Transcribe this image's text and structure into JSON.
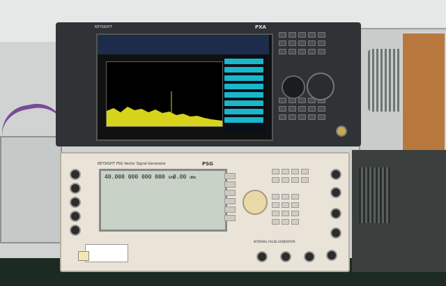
{
  "scene": {
    "description_free": true
  },
  "analyzer": {
    "brand": "KEYSIGHT",
    "model": "PXA",
    "colors": {
      "softkey": "#19b7c9",
      "trace": "#d7d31a"
    }
  },
  "generator": {
    "brand": "KEYSIGHT",
    "title": "PSG Vector Signal Generator",
    "model": "PSG",
    "frequency": "40.000 000 000 000",
    "frequency_unit": "GHz",
    "amplitude": "0.00",
    "amplitude_unit": "dBm",
    "panel_label": "INTERNAL PULSE GENERATOR"
  },
  "icons": [
    "knob-icon",
    "rf-connector-icon",
    "power-switch-icon"
  ]
}
